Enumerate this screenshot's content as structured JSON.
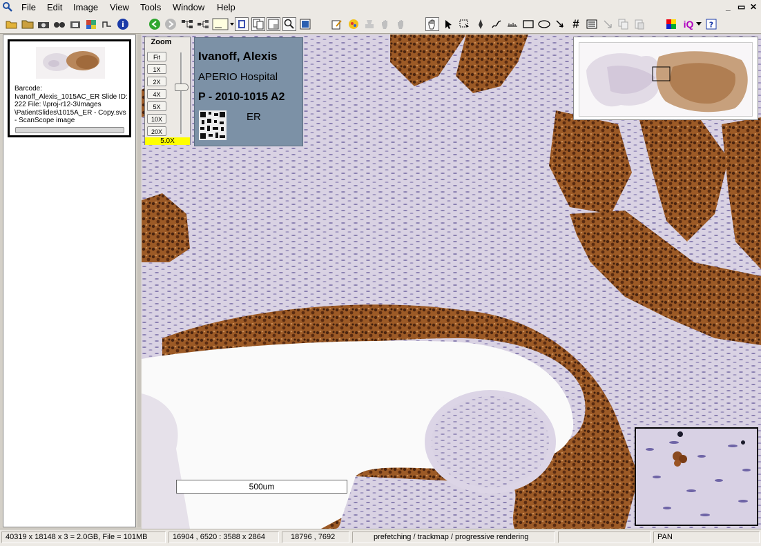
{
  "menu": [
    "File",
    "Edit",
    "Image",
    "View",
    "Tools",
    "Window",
    "Help"
  ],
  "window_controls": [
    "_",
    "▭",
    "✕"
  ],
  "toolbar": {
    "icons": [
      "open-folder-icon",
      "folder-icon",
      "camera-icon",
      "binoculars-icon",
      "camera-settings-icon",
      "puzzle-icon",
      "path-icon",
      "info-icon",
      "back-arrow-icon",
      "forward-arrow-icon",
      "tree-layout-icon",
      "tree-alt-icon",
      "frame-dropdown-icon",
      "single-view-icon",
      "dual-view-icon",
      "compare-view-icon",
      "magnifier-icon",
      "snapshot-icon",
      "edit-icon",
      "analysis-icon",
      "hand-icon",
      "stamp-icon",
      "gray-hand-icon",
      "pan-hand-icon",
      "select-arrow-icon",
      "region-select-icon",
      "pen-icon",
      "freehand-icon",
      "ruler-icon",
      "rectangle-icon",
      "ellipse-icon",
      "arrow-icon",
      "grid-hash-icon",
      "list-icon",
      "arrow-down-icon",
      "copy-icon",
      "paste-icon",
      "color-palette-icon",
      "iq-icon",
      "help-icon"
    ],
    "iq_label": "iQ"
  },
  "thumbnail": {
    "text": "Barcode: Ivanoff_Alexis_1015AC_ER  Slide ID: 222  File: \\\\proj-r12-3\\Images \\PatientSlides\\1015A_ER - Copy.svs - ScanScope image"
  },
  "zoom": {
    "title": "Zoom",
    "buttons": [
      "Fit",
      "1X",
      "2X",
      "4X",
      "5X",
      "10X",
      "20X"
    ],
    "value": "5.0X",
    "slider_fraction": 0.4
  },
  "label": {
    "name": "Ivanoff, Alexis",
    "hospital": "APERIO Hospital",
    "case": "P - 2010-1015 A2",
    "stain": "ER"
  },
  "scalebar": "500um",
  "status": {
    "image_info": "40319 x 18148 x 3 = 2.0GB, File = 101MB",
    "view_region": "16904 , 6520 : 3588 x 2864",
    "cursor": "18796 , 7692",
    "message": "prefetching / trackmap / progressive rendering",
    "empty": "",
    "mode": "PAN"
  },
  "colors": {
    "tissue_brown": "#8a4a20",
    "stroma": "#d6cfe2",
    "label_bg": "#7c91a6",
    "zoom_value_bg": "#ffff00"
  }
}
